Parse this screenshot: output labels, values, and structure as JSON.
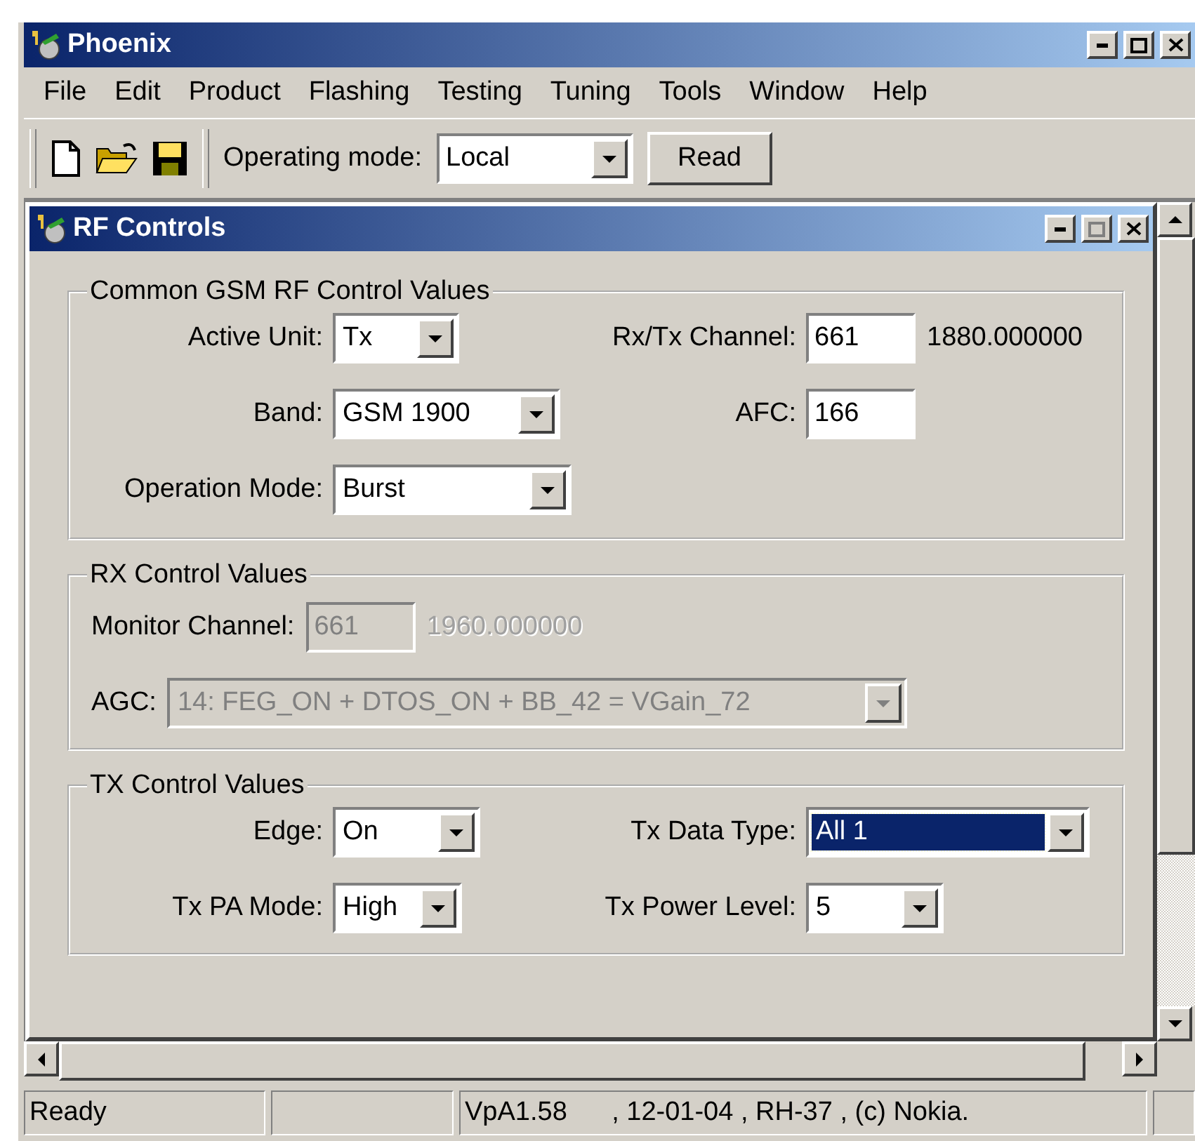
{
  "window": {
    "title": "Phoenix"
  },
  "menu": [
    "File",
    "Edit",
    "Product",
    "Flashing",
    "Testing",
    "Tuning",
    "Tools",
    "Window",
    "Help"
  ],
  "toolbar": {
    "operating_mode_label": "Operating mode:",
    "operating_mode": "Local",
    "read_button": "Read"
  },
  "child_window": {
    "title": "RF Controls"
  },
  "groups": [
    {
      "title": "Common GSM RF Control Values",
      "kind": "form",
      "rows": [
        {
          "fields": [
            {
              "kind": "combo",
              "label": "Active Unit:",
              "value": "Tx",
              "disabled": false,
              "highlighted": false
            },
            {
              "kind": "input",
              "label": "Rx/Tx Channel:",
              "value": "661",
              "suffix": "1880.000000",
              "disabled": false
            }
          ]
        },
        {
          "fields": [
            {
              "kind": "combo",
              "label": "Band:",
              "value": "GSM 1900",
              "disabled": false,
              "highlighted": false
            },
            {
              "kind": "input",
              "label": "AFC:",
              "value": "166",
              "disabled": false
            }
          ]
        },
        {
          "fields": [
            {
              "kind": "combo",
              "label": "Operation Mode:",
              "value": "Burst",
              "disabled": false,
              "highlighted": false
            }
          ]
        }
      ]
    },
    {
      "title": "RX Control Values",
      "kind": "plain",
      "rows": [
        {
          "fields": [
            {
              "kind": "input",
              "label": "Monitor Channel:",
              "value": "661",
              "suffix": "1960.000000",
              "disabled": true
            }
          ]
        },
        {
          "fields": [
            {
              "kind": "combo",
              "label": "AGC:",
              "value": "14: FEG_ON + DTOS_ON + BB_42 = VGain_72",
              "disabled": true,
              "highlighted": false
            }
          ]
        }
      ]
    },
    {
      "title": "TX Control Values",
      "kind": "form",
      "rows": [
        {
          "fields": [
            {
              "kind": "combo",
              "label": "Edge:",
              "value": "On",
              "disabled": false,
              "highlighted": false
            },
            {
              "kind": "combo",
              "label": "Tx Data Type:",
              "value": "All 1",
              "disabled": false,
              "highlighted": true
            }
          ]
        },
        {
          "fields": [
            {
              "kind": "combo",
              "label": "Tx PA Mode:",
              "value": "High",
              "disabled": false,
              "highlighted": false
            },
            {
              "kind": "combo",
              "label": "Tx Power Level:",
              "value": "5",
              "disabled": false,
              "highlighted": false
            }
          ]
        }
      ]
    }
  ],
  "status_bar": {
    "message": "Ready",
    "info": "VpA1.58      , 12-01-04 , RH-37 , (c) Nokia."
  }
}
